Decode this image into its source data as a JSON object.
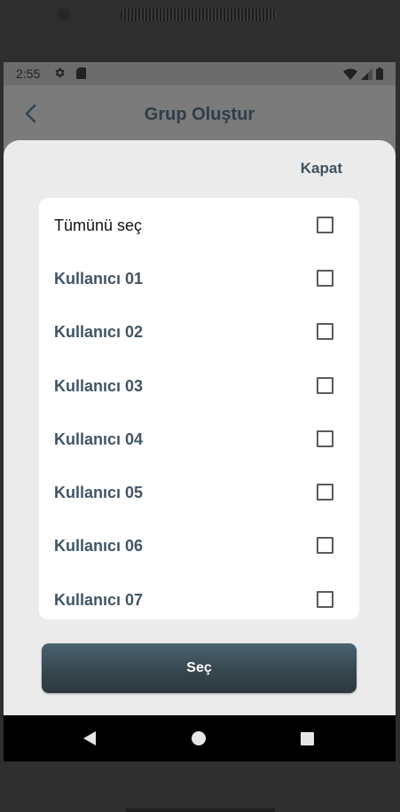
{
  "status_bar": {
    "time": "2:55"
  },
  "header": {
    "title": "Grup Oluştur"
  },
  "sheet": {
    "close_label": "Kapat",
    "select_all_label": "Tümünü seç",
    "users": [
      {
        "label": "Kullanıcı 01"
      },
      {
        "label": "Kullanıcı 02"
      },
      {
        "label": "Kullanıcı 03"
      },
      {
        "label": "Kullanıcı 04"
      },
      {
        "label": "Kullanıcı 05"
      },
      {
        "label": "Kullanıcı 06"
      },
      {
        "label": "Kullanıcı 07"
      }
    ],
    "select_button_label": "Seç"
  },
  "colors": {
    "accent": "#3f5565",
    "button": "#37474f",
    "sheet_bg": "#ebebeb"
  }
}
